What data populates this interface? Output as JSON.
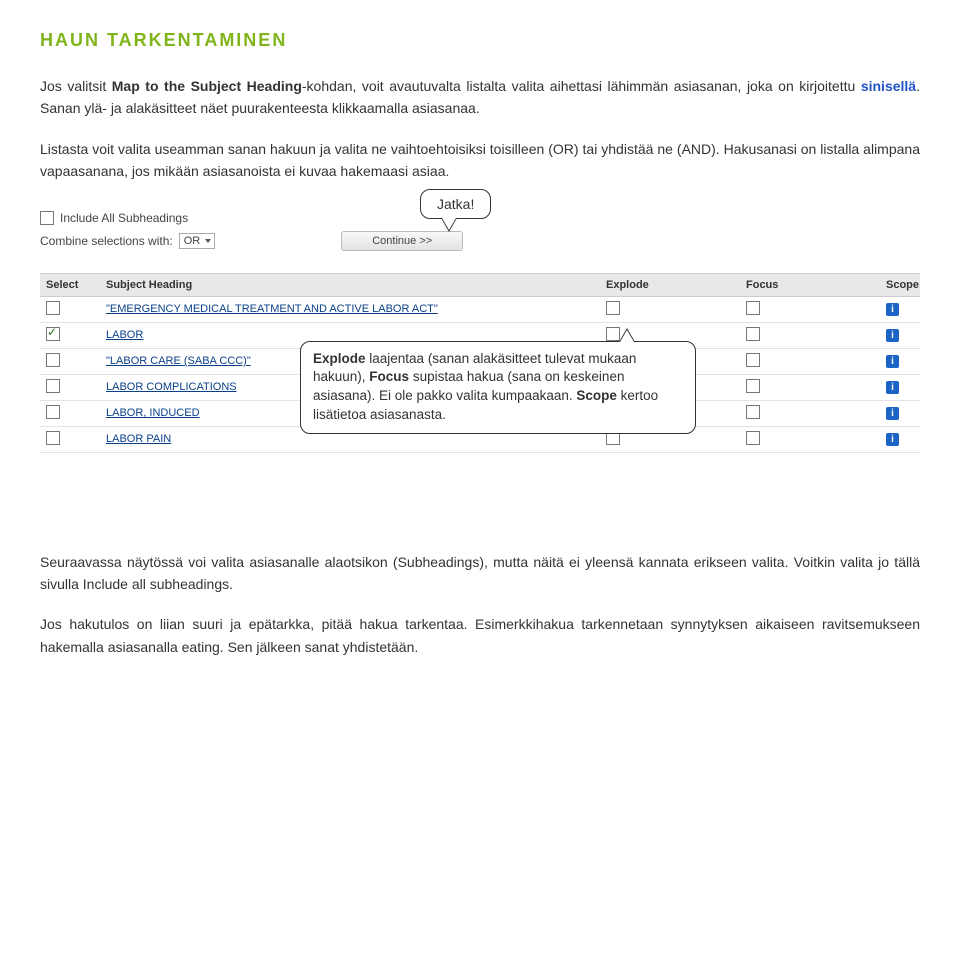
{
  "heading": "HAUN TARKENTAMINEN",
  "p1": {
    "t1": "Jos valitsit ",
    "bold1": "Map to the Subject Heading",
    "t2": "-kohdan, voit avautuvalta listalta valita aihettasi lähimmän asiasanan, joka on kirjoitettu ",
    "blue1": "sinisellä",
    "t3": ". Sanan ylä- ja alakäsitteet näet puurakenteesta klikkaamalla asiasanaa."
  },
  "p2": "Listasta voit valita useamman sanan hakuun ja valita ne vaihtoehtoisiksi toisilleen (OR) tai yhdistää ne (AND). Hakusanasi on listalla alimpana vapaasanana, jos mikään asiasanoista ei kuvaa hakemaasi asiaa.",
  "ui": {
    "include_label": "Include All Subheadings",
    "combine_label": "Combine selections with:",
    "or_text": "OR",
    "continue_label": "Continue >>",
    "callout1": "Jatka!",
    "headers": {
      "select": "Select",
      "subj": "Subject Heading",
      "explode": "Explode",
      "focus": "Focus",
      "scope": "Scope"
    },
    "rows": [
      {
        "label": "\"EMERGENCY MEDICAL TREATMENT AND ACTIVE LABOR ACT\"",
        "checked": false
      },
      {
        "label": "LABOR",
        "checked": true
      },
      {
        "label": "\"LABOR CARE (SABA CCC)\"",
        "checked": false
      },
      {
        "label": "LABOR COMPLICATIONS",
        "checked": false
      },
      {
        "label": "LABOR, INDUCED",
        "checked": false
      },
      {
        "label": "LABOR PAIN",
        "checked": false
      }
    ],
    "callout2": {
      "t1": "Explode",
      "t2": " laajentaa (sanan alakäsitteet tulevat mukaan hakuun), ",
      "t3": "Focus",
      "t4": " supistaa hakua (sana on keskeinen asiasana). Ei ole pakko valita kumpaakaan. ",
      "t5": "Scope",
      "t6": " kertoo lisätietoa asiasanasta."
    }
  },
  "p3": "Seuraavassa näytössä voi valita asiasanalle alaotsikon (Subheadings), mutta näitä ei yleensä kannata erikseen valita. Voitkin valita jo tällä sivulla Include all subheadings.",
  "p4": "Jos hakutulos on liian suuri ja epätarkka, pitää hakua tarkentaa. Esimerkkihakua tarkennetaan synnytyksen aikaiseen ravitsemukseen hakemalla asiasanalla eating. Sen jälkeen sanat yhdistetään."
}
